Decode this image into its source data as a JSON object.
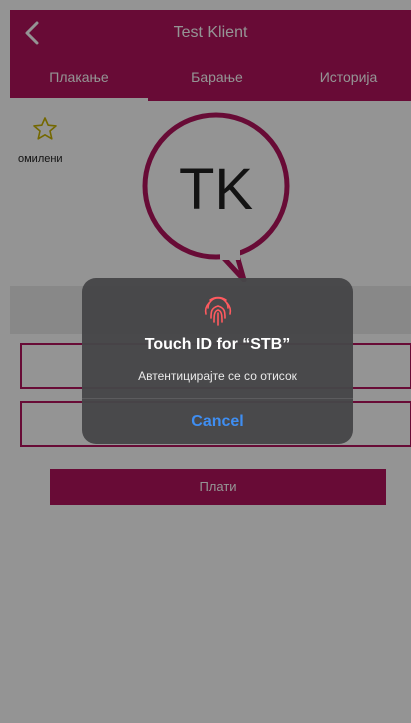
{
  "header": {
    "title": "Test Klient",
    "back_icon": "chevron-left-icon"
  },
  "tabs": [
    {
      "label": "Плакање",
      "active": true
    },
    {
      "label": "Барање",
      "active": false
    },
    {
      "label": "Историја",
      "active": false
    }
  ],
  "favorites": {
    "label": "омилени",
    "icon": "star-outline-icon"
  },
  "avatar": {
    "initials": "TK"
  },
  "actions": {
    "pay_label": "Плати"
  },
  "alert": {
    "icon": "fingerprint-icon",
    "title": "Touch ID for “STB”",
    "message": "Автентицирајте се со отисок",
    "cancel_label": "Cancel"
  },
  "colors": {
    "brand": "#b3145e",
    "alert_button": "#3f8ef2"
  }
}
